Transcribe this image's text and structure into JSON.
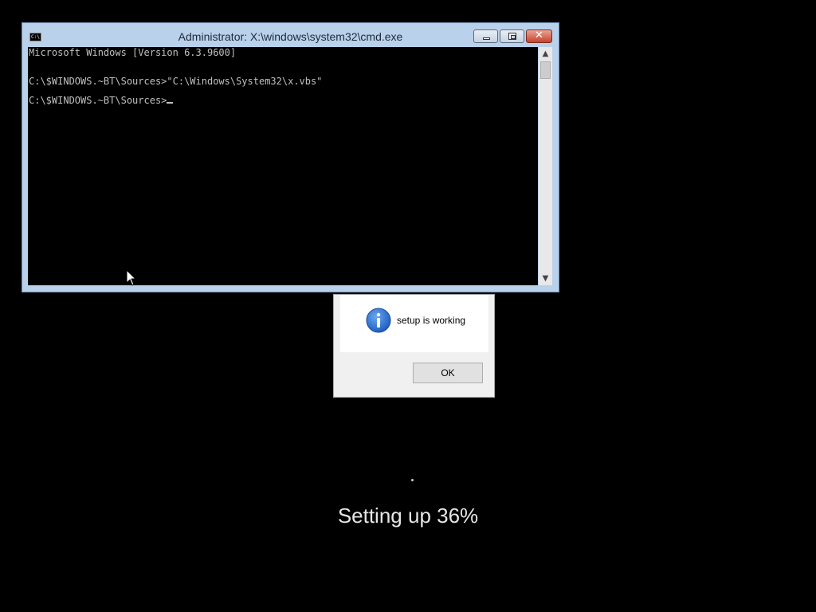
{
  "cmd_window": {
    "title": "Administrator: X:\\windows\\system32\\cmd.exe",
    "icon_label": "C:\\",
    "lines": [
      "Microsoft Windows [Version 6.3.9600]",
      "",
      "C:\\$WINDOWS.~BT\\Sources>\"C:\\Windows\\System32\\x.vbs\"",
      "",
      "C:\\$WINDOWS.~BT\\Sources>"
    ],
    "icons": {
      "app": "cmd-icon",
      "minimize": "minimize-icon",
      "maximize": "maximize-icon",
      "close": "close-icon",
      "scroll_up": "scroll-up-arrow-icon",
      "scroll_down": "scroll-down-arrow-icon"
    }
  },
  "message_box": {
    "icon": "info-icon",
    "text": "setup is working",
    "ok_label": "OK"
  },
  "setup": {
    "progress_text": "Setting up 36%",
    "progress_percent": 36
  },
  "colors": {
    "background": "#000000",
    "console_text": "#c0c0c0",
    "info_blue": "#1f5fc2",
    "close_red": "#c7422c"
  }
}
